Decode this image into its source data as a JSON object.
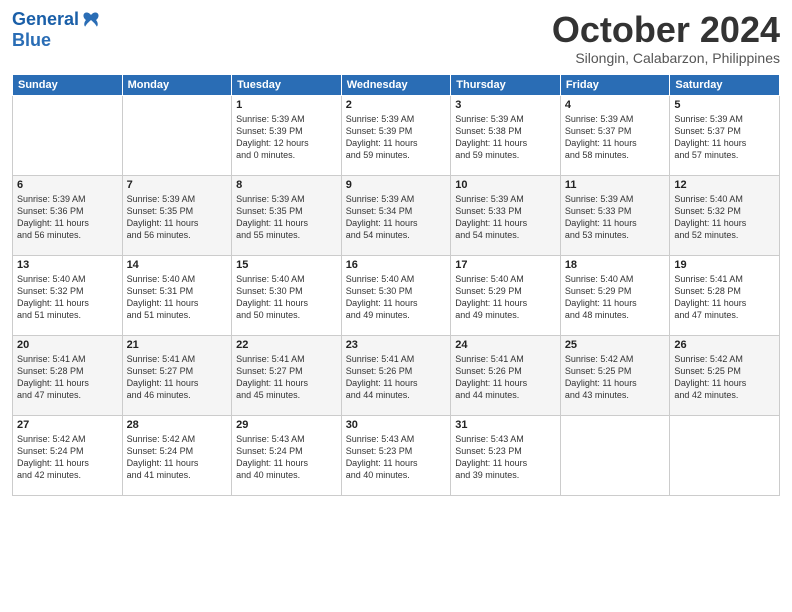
{
  "header": {
    "logo_line1": "General",
    "logo_line2": "Blue",
    "month": "October 2024",
    "location": "Silongin, Calabarzon, Philippines"
  },
  "weekdays": [
    "Sunday",
    "Monday",
    "Tuesday",
    "Wednesday",
    "Thursday",
    "Friday",
    "Saturday"
  ],
  "weeks": [
    [
      {
        "day": "",
        "info": ""
      },
      {
        "day": "",
        "info": ""
      },
      {
        "day": "1",
        "info": "Sunrise: 5:39 AM\nSunset: 5:39 PM\nDaylight: 12 hours\nand 0 minutes."
      },
      {
        "day": "2",
        "info": "Sunrise: 5:39 AM\nSunset: 5:39 PM\nDaylight: 11 hours\nand 59 minutes."
      },
      {
        "day": "3",
        "info": "Sunrise: 5:39 AM\nSunset: 5:38 PM\nDaylight: 11 hours\nand 59 minutes."
      },
      {
        "day": "4",
        "info": "Sunrise: 5:39 AM\nSunset: 5:37 PM\nDaylight: 11 hours\nand 58 minutes."
      },
      {
        "day": "5",
        "info": "Sunrise: 5:39 AM\nSunset: 5:37 PM\nDaylight: 11 hours\nand 57 minutes."
      }
    ],
    [
      {
        "day": "6",
        "info": "Sunrise: 5:39 AM\nSunset: 5:36 PM\nDaylight: 11 hours\nand 56 minutes."
      },
      {
        "day": "7",
        "info": "Sunrise: 5:39 AM\nSunset: 5:35 PM\nDaylight: 11 hours\nand 56 minutes."
      },
      {
        "day": "8",
        "info": "Sunrise: 5:39 AM\nSunset: 5:35 PM\nDaylight: 11 hours\nand 55 minutes."
      },
      {
        "day": "9",
        "info": "Sunrise: 5:39 AM\nSunset: 5:34 PM\nDaylight: 11 hours\nand 54 minutes."
      },
      {
        "day": "10",
        "info": "Sunrise: 5:39 AM\nSunset: 5:33 PM\nDaylight: 11 hours\nand 54 minutes."
      },
      {
        "day": "11",
        "info": "Sunrise: 5:39 AM\nSunset: 5:33 PM\nDaylight: 11 hours\nand 53 minutes."
      },
      {
        "day": "12",
        "info": "Sunrise: 5:40 AM\nSunset: 5:32 PM\nDaylight: 11 hours\nand 52 minutes."
      }
    ],
    [
      {
        "day": "13",
        "info": "Sunrise: 5:40 AM\nSunset: 5:32 PM\nDaylight: 11 hours\nand 51 minutes."
      },
      {
        "day": "14",
        "info": "Sunrise: 5:40 AM\nSunset: 5:31 PM\nDaylight: 11 hours\nand 51 minutes."
      },
      {
        "day": "15",
        "info": "Sunrise: 5:40 AM\nSunset: 5:30 PM\nDaylight: 11 hours\nand 50 minutes."
      },
      {
        "day": "16",
        "info": "Sunrise: 5:40 AM\nSunset: 5:30 PM\nDaylight: 11 hours\nand 49 minutes."
      },
      {
        "day": "17",
        "info": "Sunrise: 5:40 AM\nSunset: 5:29 PM\nDaylight: 11 hours\nand 49 minutes."
      },
      {
        "day": "18",
        "info": "Sunrise: 5:40 AM\nSunset: 5:29 PM\nDaylight: 11 hours\nand 48 minutes."
      },
      {
        "day": "19",
        "info": "Sunrise: 5:41 AM\nSunset: 5:28 PM\nDaylight: 11 hours\nand 47 minutes."
      }
    ],
    [
      {
        "day": "20",
        "info": "Sunrise: 5:41 AM\nSunset: 5:28 PM\nDaylight: 11 hours\nand 47 minutes."
      },
      {
        "day": "21",
        "info": "Sunrise: 5:41 AM\nSunset: 5:27 PM\nDaylight: 11 hours\nand 46 minutes."
      },
      {
        "day": "22",
        "info": "Sunrise: 5:41 AM\nSunset: 5:27 PM\nDaylight: 11 hours\nand 45 minutes."
      },
      {
        "day": "23",
        "info": "Sunrise: 5:41 AM\nSunset: 5:26 PM\nDaylight: 11 hours\nand 44 minutes."
      },
      {
        "day": "24",
        "info": "Sunrise: 5:41 AM\nSunset: 5:26 PM\nDaylight: 11 hours\nand 44 minutes."
      },
      {
        "day": "25",
        "info": "Sunrise: 5:42 AM\nSunset: 5:25 PM\nDaylight: 11 hours\nand 43 minutes."
      },
      {
        "day": "26",
        "info": "Sunrise: 5:42 AM\nSunset: 5:25 PM\nDaylight: 11 hours\nand 42 minutes."
      }
    ],
    [
      {
        "day": "27",
        "info": "Sunrise: 5:42 AM\nSunset: 5:24 PM\nDaylight: 11 hours\nand 42 minutes."
      },
      {
        "day": "28",
        "info": "Sunrise: 5:42 AM\nSunset: 5:24 PM\nDaylight: 11 hours\nand 41 minutes."
      },
      {
        "day": "29",
        "info": "Sunrise: 5:43 AM\nSunset: 5:24 PM\nDaylight: 11 hours\nand 40 minutes."
      },
      {
        "day": "30",
        "info": "Sunrise: 5:43 AM\nSunset: 5:23 PM\nDaylight: 11 hours\nand 40 minutes."
      },
      {
        "day": "31",
        "info": "Sunrise: 5:43 AM\nSunset: 5:23 PM\nDaylight: 11 hours\nand 39 minutes."
      },
      {
        "day": "",
        "info": ""
      },
      {
        "day": "",
        "info": ""
      }
    ]
  ]
}
